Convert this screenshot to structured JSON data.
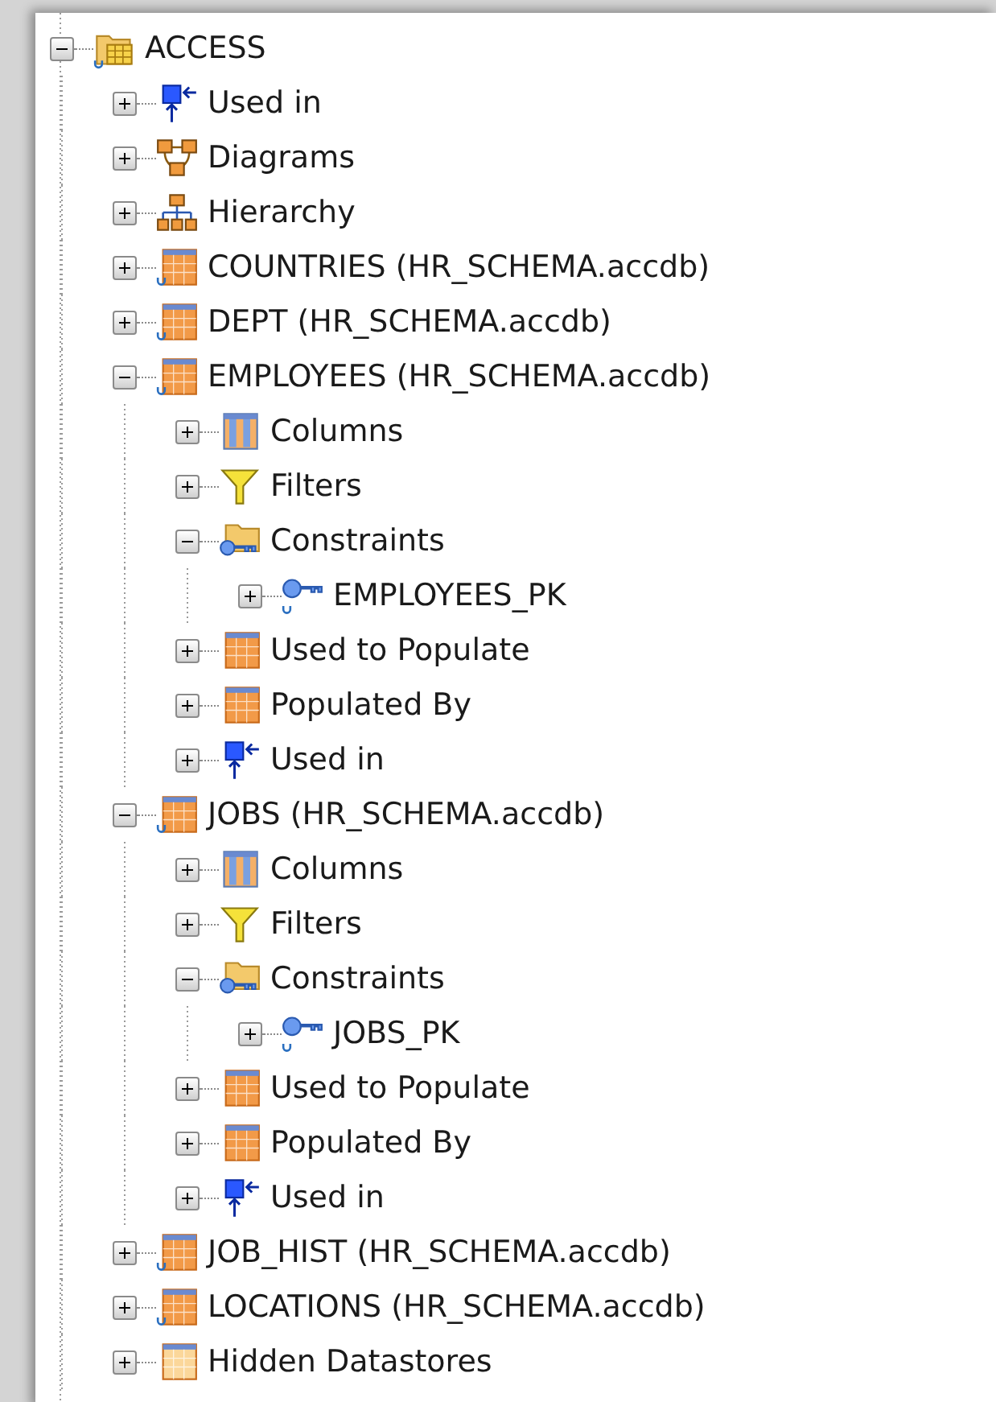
{
  "tree": [
    {
      "label": "ACCESS",
      "kind": "model",
      "expanded": true,
      "children": [
        {
          "label": "Used in",
          "kind": "used-in",
          "expanded": false
        },
        {
          "label": "Diagrams",
          "kind": "diagrams",
          "expanded": false
        },
        {
          "label": "Hierarchy",
          "kind": "hierarchy",
          "expanded": false
        },
        {
          "label": "COUNTRIES (HR_SCHEMA.accdb)",
          "kind": "datastore",
          "expanded": false
        },
        {
          "label": "DEPT (HR_SCHEMA.accdb)",
          "kind": "datastore",
          "expanded": false
        },
        {
          "label": "EMPLOYEES (HR_SCHEMA.accdb)",
          "kind": "datastore",
          "expanded": true,
          "children": [
            {
              "label": "Columns",
              "kind": "columns",
              "expanded": false
            },
            {
              "label": "Filters",
              "kind": "filter",
              "expanded": false
            },
            {
              "label": "Constraints",
              "kind": "constraints",
              "expanded": true,
              "children": [
                {
                  "label": "EMPLOYEES_PK",
                  "kind": "key",
                  "expanded": false
                }
              ]
            },
            {
              "label": "Used to Populate",
              "kind": "table",
              "expanded": false
            },
            {
              "label": "Populated By",
              "kind": "table",
              "expanded": false
            },
            {
              "label": "Used in",
              "kind": "used-in",
              "expanded": false
            }
          ]
        },
        {
          "label": "JOBS (HR_SCHEMA.accdb)",
          "kind": "datastore",
          "expanded": true,
          "children": [
            {
              "label": "Columns",
              "kind": "columns",
              "expanded": false
            },
            {
              "label": "Filters",
              "kind": "filter",
              "expanded": false
            },
            {
              "label": "Constraints",
              "kind": "constraints",
              "expanded": true,
              "children": [
                {
                  "label": "JOBS_PK",
                  "kind": "key",
                  "expanded": false
                }
              ]
            },
            {
              "label": "Used to Populate",
              "kind": "table",
              "expanded": false
            },
            {
              "label": "Populated By",
              "kind": "table",
              "expanded": false
            },
            {
              "label": "Used in",
              "kind": "used-in",
              "expanded": false
            }
          ]
        },
        {
          "label": "JOB_HIST (HR_SCHEMA.accdb)",
          "kind": "datastore",
          "expanded": false
        },
        {
          "label": "LOCATIONS (HR_SCHEMA.accdb)",
          "kind": "datastore",
          "expanded": false
        },
        {
          "label": "Hidden Datastores",
          "kind": "hidden",
          "expanded": false
        }
      ]
    }
  ]
}
